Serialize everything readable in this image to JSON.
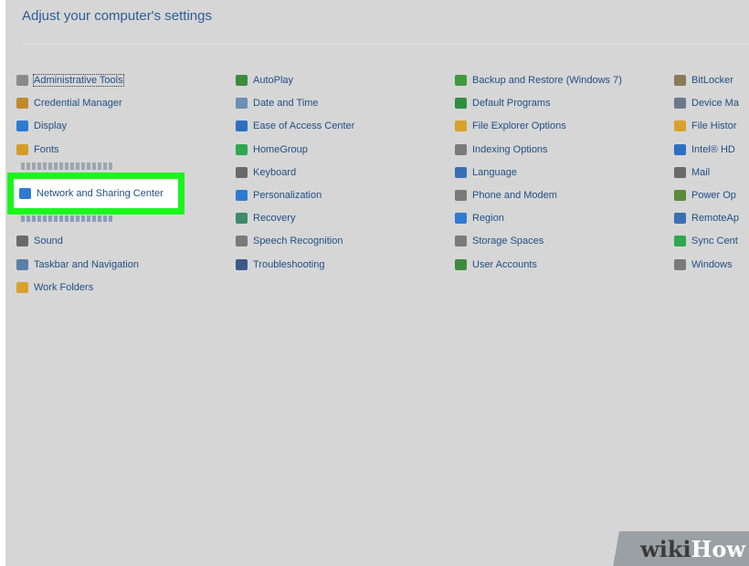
{
  "heading": "Adjust your computer's settings",
  "columns": [
    [
      {
        "label": "Administrative Tools",
        "icon": "admin-tools-icon",
        "color": "#8a8a8a"
      },
      {
        "label": "Credential Manager",
        "icon": "credential-manager-icon",
        "color": "#c08a2a"
      },
      {
        "label": "Display",
        "icon": "display-icon",
        "color": "#2f7bd1"
      },
      {
        "label": "Fonts",
        "icon": "fonts-icon",
        "color": "#d39b2a"
      },
      {
        "label": "Java (32-bit)",
        "icon": "java-icon",
        "color": "#c0392b"
      },
      {
        "label": "Network and Sharing Center",
        "icon": "network-icon",
        "color": "#2f7bd1"
      },
      {
        "label": "QuickTime (32-bit)",
        "icon": "quicktime-icon",
        "color": "#2f7bd1"
      },
      {
        "label": "Sound",
        "icon": "sound-icon",
        "color": "#6a6a6a"
      },
      {
        "label": "Taskbar and Navigation",
        "icon": "taskbar-icon",
        "color": "#5a7fa8"
      },
      {
        "label": "Work Folders",
        "icon": "work-folders-icon",
        "color": "#d9a22e"
      }
    ],
    [
      {
        "label": "AutoPlay",
        "icon": "autoplay-icon",
        "color": "#3d8b3d"
      },
      {
        "label": "Date and Time",
        "icon": "date-time-icon",
        "color": "#6a8fb5"
      },
      {
        "label": "Ease of Access Center",
        "icon": "ease-access-icon",
        "color": "#2f6fc1"
      },
      {
        "label": "HomeGroup",
        "icon": "homegroup-icon",
        "color": "#2fa84f"
      },
      {
        "label": "Keyboard",
        "icon": "keyboard-icon",
        "color": "#6a6a6a"
      },
      {
        "label": "Personalization",
        "icon": "personalization-icon",
        "color": "#2f7bd1"
      },
      {
        "label": "Recovery",
        "icon": "recovery-icon",
        "color": "#3d8b6a"
      },
      {
        "label": "Speech Recognition",
        "icon": "microphone-icon",
        "color": "#7a7a7a"
      },
      {
        "label": "Troubleshooting",
        "icon": "troubleshooting-icon",
        "color": "#3a5a8a"
      }
    ],
    [
      {
        "label": "Backup and Restore (Windows 7)",
        "icon": "backup-restore-icon",
        "color": "#3d9b3d"
      },
      {
        "label": "Default Programs",
        "icon": "default-programs-icon",
        "color": "#2f8f3f"
      },
      {
        "label": "File Explorer Options",
        "icon": "folder-options-icon",
        "color": "#d9a22e"
      },
      {
        "label": "Indexing Options",
        "icon": "indexing-icon",
        "color": "#7a7a7a"
      },
      {
        "label": "Language",
        "icon": "language-icon",
        "color": "#3a6fb5"
      },
      {
        "label": "Phone and Modem",
        "icon": "phone-modem-icon",
        "color": "#7a7a7a"
      },
      {
        "label": "Region",
        "icon": "region-icon",
        "color": "#2f7bd1"
      },
      {
        "label": "Storage Spaces",
        "icon": "storage-spaces-icon",
        "color": "#7a7a7a"
      },
      {
        "label": "User Accounts",
        "icon": "user-accounts-icon",
        "color": "#3d8b3d"
      }
    ],
    [
      {
        "label": "BitLocker",
        "icon": "bitlocker-icon",
        "color": "#8a7a5a"
      },
      {
        "label": "Device Ma",
        "icon": "device-manager-icon",
        "color": "#6a7a8a"
      },
      {
        "label": "File Histor",
        "icon": "file-history-icon",
        "color": "#d9a22e"
      },
      {
        "label": "Intel® HD",
        "icon": "intel-graphics-icon",
        "color": "#2f6fc1"
      },
      {
        "label": "Mail",
        "icon": "mail-icon",
        "color": "#6a6a6a"
      },
      {
        "label": "Power Op",
        "icon": "power-options-icon",
        "color": "#5a8a3a"
      },
      {
        "label": "RemoteAp",
        "icon": "remoteapp-icon",
        "color": "#3a6fb5"
      },
      {
        "label": "Sync Cent",
        "icon": "sync-center-icon",
        "color": "#2fa84f"
      },
      {
        "label": "Windows",
        "icon": "windows-icon",
        "color": "#7a7a7a"
      }
    ]
  ],
  "watermark": {
    "part1": "wiki",
    "part2": "How"
  }
}
